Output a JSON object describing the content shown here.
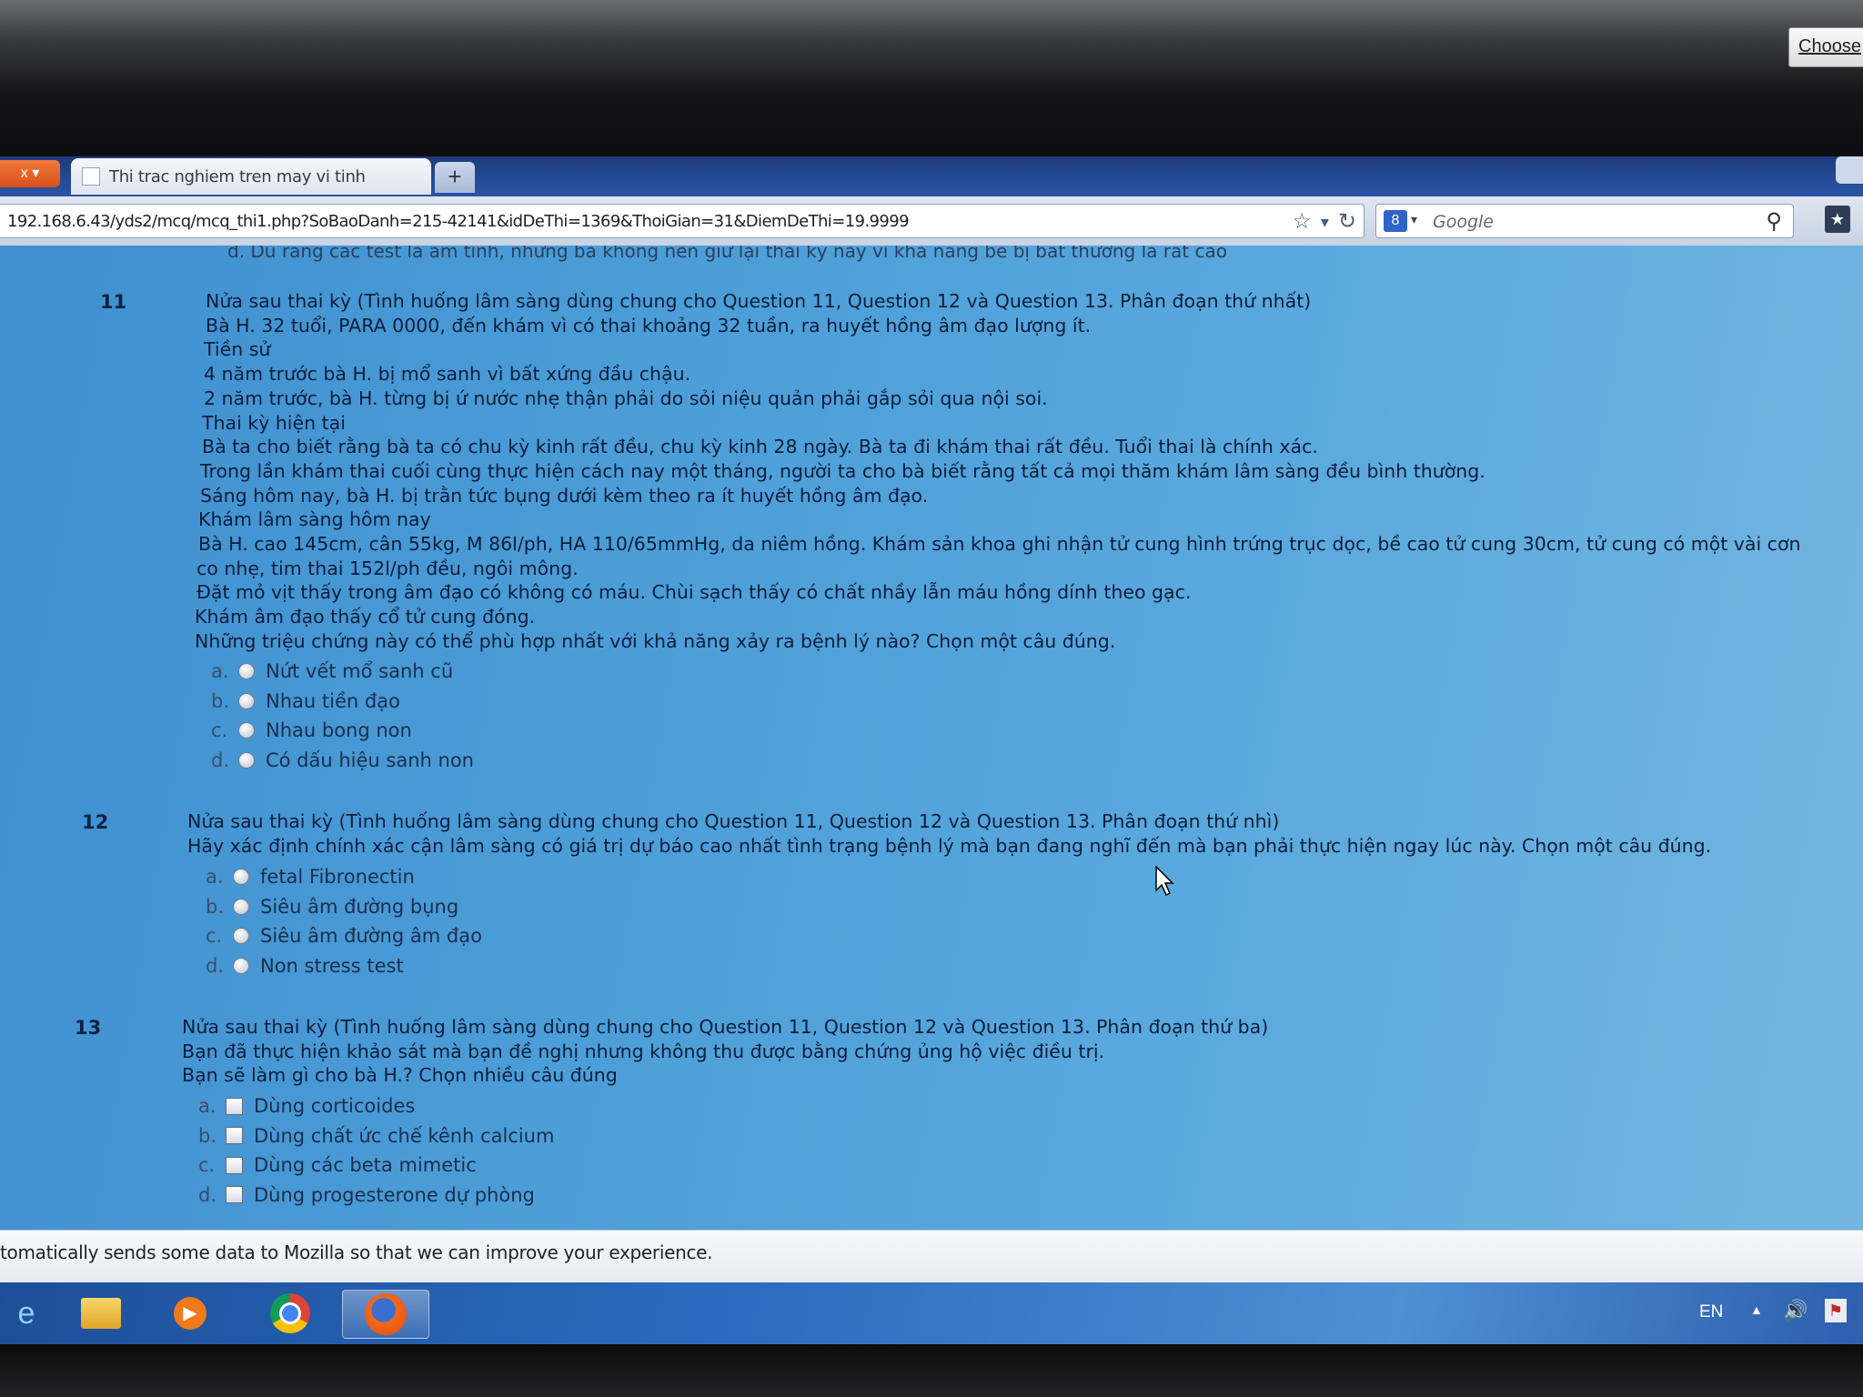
{
  "browser": {
    "tab_title": "Thi trac nghiem tren may vi tinh",
    "new_tab_label": "+",
    "url": "192.168.6.43/yds2/mcq/mcq_thi1.php?SoBaoDanh=215-42141&idDeThi=1369&ThoiGian=31&DiemDeThi=19.9999",
    "search_placeholder": "Google",
    "search_engine_badge": "8"
  },
  "page": {
    "cutoff_line": "d.  Dù rằng các test là âm tính, nhưng bà không nên giữ lại thai kỳ này vì khả năng bé bị bất thường là rất cao",
    "questions": [
      {
        "number": "11",
        "lines": [
          "Nửa sau thai kỳ (Tình huống lâm sàng dùng chung cho Question 11, Question 12 và Question 13. Phân đoạn thứ nhất)",
          "Bà H. 32 tuổi, PARA 0000, đến khám vì có thai khoảng 32 tuần, ra huyết hồng âm đạo lượng ít.",
          "Tiền sử",
          "4 năm trước bà H. bị mổ sanh vì bất xứng đầu chậu.",
          "2 năm trước, bà H. từng bị ứ nước nhẹ thận phải do sỏi niệu quản phải gắp sỏi qua nội soi.",
          "Thai kỳ hiện tại",
          "Bà ta cho biết rằng bà ta có chu kỳ kinh rất đều, chu kỳ kinh 28 ngày. Bà ta đi khám thai rất đều. Tuổi thai là chính xác.",
          "Trong lần khám thai cuối cùng thực hiện cách nay một tháng, người ta cho bà biết rằng tất cả mọi thăm khám lâm sàng đều bình thường.",
          "Sáng hôm nay, bà H. bị trằn tức bụng dưới kèm theo ra ít huyết hồng âm đạo.",
          "Khám lâm sàng hôm nay",
          "Bà H. cao 145cm, cân 55kg, M 86l/ph, HA 110/65mmHg, da niêm hồng. Khám sản khoa ghi nhận tử cung hình trứng trục dọc, bề cao tử cung 30cm, tử cung có một vài cơn",
          "co nhẹ, tim thai 152l/ph đều, ngôi mông.",
          "Đặt mỏ vịt thấy trong âm đạo có không có máu. Chùi sạch thấy có chất nhầy lẫn máu hồng dính theo gạc.",
          "Khám âm đạo thấy cổ tử cung đóng.",
          "Những triệu chứng này có thể phù hợp nhất với khả năng xảy ra bệnh lý nào? Chọn một câu đúng."
        ],
        "type": "radio",
        "options": [
          {
            "letter": "a.",
            "text": "Nứt vết mổ sanh cũ"
          },
          {
            "letter": "b.",
            "text": "Nhau tiền đạo"
          },
          {
            "letter": "c.",
            "text": "Nhau bong non"
          },
          {
            "letter": "d.",
            "text": "Có dấu hiệu sanh non"
          }
        ]
      },
      {
        "number": "12",
        "lines": [
          "Nửa sau thai kỳ (Tình huống lâm sàng dùng chung cho Question 11, Question 12 và Question 13. Phân đoạn thứ nhì)",
          "Hãy xác định chính xác cận lâm sàng có giá trị dự báo cao nhất tình trạng bệnh lý mà bạn đang nghĩ đến mà bạn phải thực hiện ngay lúc này. Chọn một câu đúng."
        ],
        "type": "radio",
        "options": [
          {
            "letter": "a.",
            "text": "fetal Fibronectin"
          },
          {
            "letter": "b.",
            "text": "Siêu âm đường bụng"
          },
          {
            "letter": "c.",
            "text": "Siêu âm đường âm đạo"
          },
          {
            "letter": "d.",
            "text": "Non stress test"
          }
        ]
      },
      {
        "number": "13",
        "lines": [
          "Nửa sau thai kỳ (Tình huống lâm sàng dùng chung cho Question 11, Question 12 và Question 13. Phân đoạn thứ ba)",
          "Bạn đã thực hiện khảo sát mà bạn đề nghị nhưng không thu được bằng chứng ủng hộ việc điều trị.",
          "Bạn sẽ làm gì cho bà H.? Chọn nhiều câu đúng"
        ],
        "type": "checkbox",
        "options": [
          {
            "letter": "a.",
            "text": "Dùng corticoides"
          },
          {
            "letter": "b.",
            "text": "Dùng chất ức chế kênh calcium"
          },
          {
            "letter": "c.",
            "text": "Dùng các beta mimetic"
          },
          {
            "letter": "d.",
            "text": "Dùng progesterone dự phòng"
          }
        ]
      }
    ]
  },
  "notification": {
    "text": "tomatically sends some data to Mozilla so that we can improve your experience.",
    "button_label": "Choose"
  },
  "taskbar": {
    "apps": [
      "internet-explorer-icon",
      "file-explorer-icon",
      "media-player-icon",
      "chrome-icon",
      "firefox-icon"
    ],
    "language": "EN"
  },
  "colors": {
    "page_background": "#4c9ed8",
    "tabstrip": "#2a54a8",
    "taskbar": "#2b6cc0"
  }
}
